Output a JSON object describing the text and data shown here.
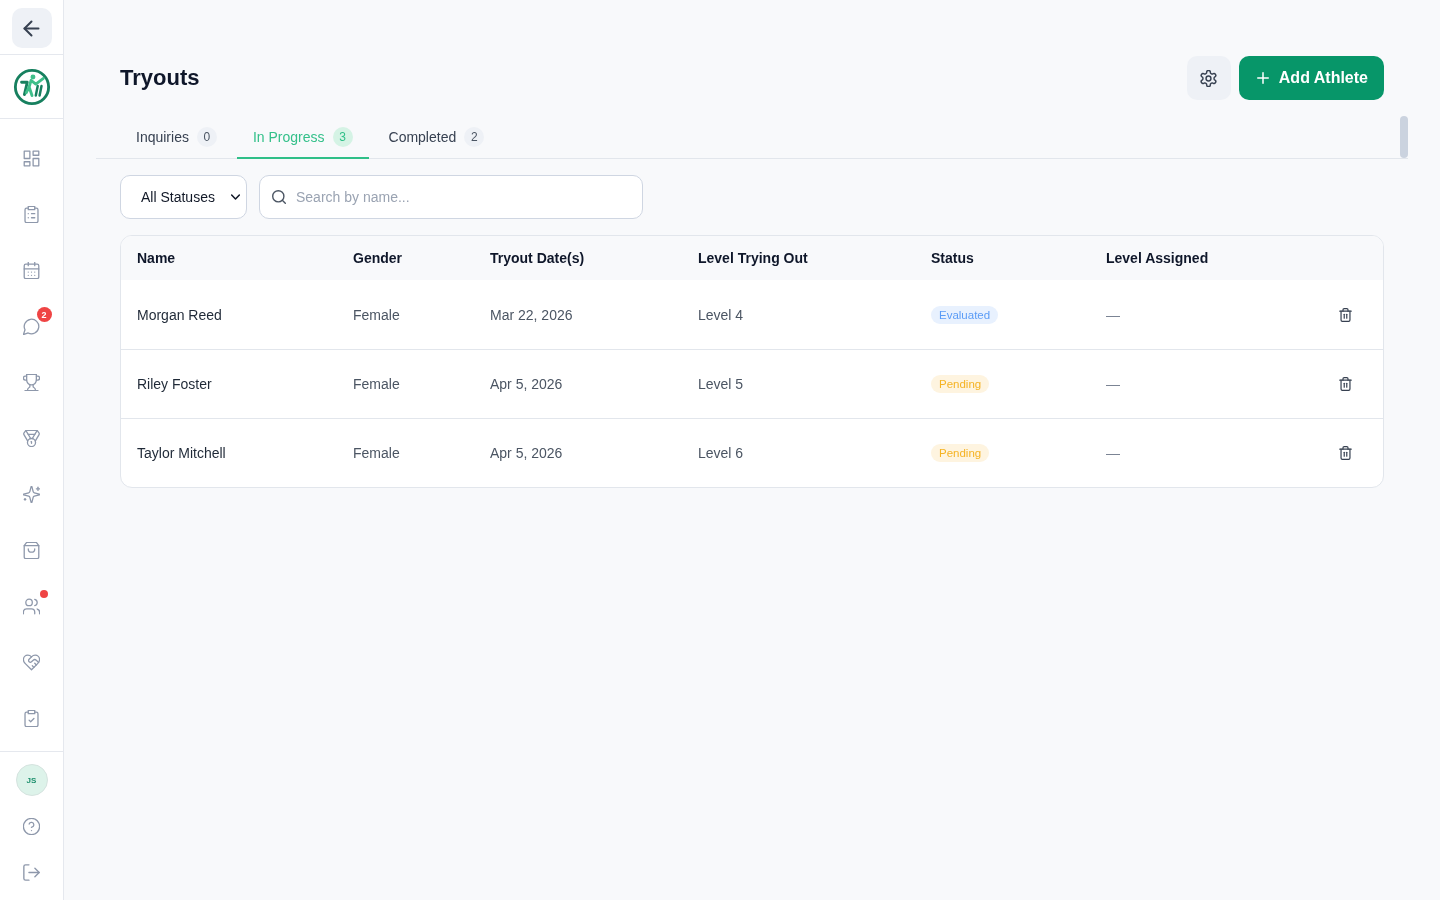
{
  "sidebar": {
    "items": [
      {
        "alert": false
      },
      {
        "alert": false
      },
      {
        "alert": false
      },
      {
        "alert": false,
        "badge": "2"
      },
      {
        "alert": false
      },
      {
        "alert": false
      },
      {
        "alert": false
      },
      {
        "alert": false
      },
      {
        "alert": true
      },
      {
        "alert": false
      },
      {
        "alert": false
      }
    ],
    "user": {
      "initials": "JS"
    }
  },
  "header": {
    "title": "Tryouts",
    "primary_button": "Add Athlete"
  },
  "tabs": [
    {
      "label": "Inquiries",
      "count": "0",
      "selected": false
    },
    {
      "label": "In Progress",
      "count": "3",
      "selected": true
    },
    {
      "label": "Completed",
      "count": "2",
      "selected": false
    }
  ],
  "filters": {
    "status": "All Statuses",
    "search": {
      "placeholder": "Search by name..."
    }
  },
  "table": {
    "columns": [
      "Name",
      "Gender",
      "Tryout Date(s)",
      "Level Trying Out",
      "Status",
      "Level Assigned"
    ],
    "rows": [
      {
        "name": "Morgan Reed",
        "gender": "Female",
        "tryout_dates": "Mar 22, 2026",
        "level_trying_out": "Level 4",
        "status": {
          "label": "Evaluated",
          "color": "#5b9cf6"
        },
        "level_assigned": "—"
      },
      {
        "name": "Riley Foster",
        "gender": "Female",
        "tryout_dates": "Apr 5, 2026",
        "level_trying_out": "Level 5",
        "status": {
          "label": "Pending",
          "color": "#f5b324"
        },
        "level_assigned": "—"
      },
      {
        "name": "Taylor Mitchell",
        "gender": "Female",
        "tryout_dates": "Apr 5, 2026",
        "level_trying_out": "Level 6",
        "status": {
          "label": "Pending",
          "color": "#f5b324"
        },
        "level_assigned": "—"
      }
    ]
  }
}
